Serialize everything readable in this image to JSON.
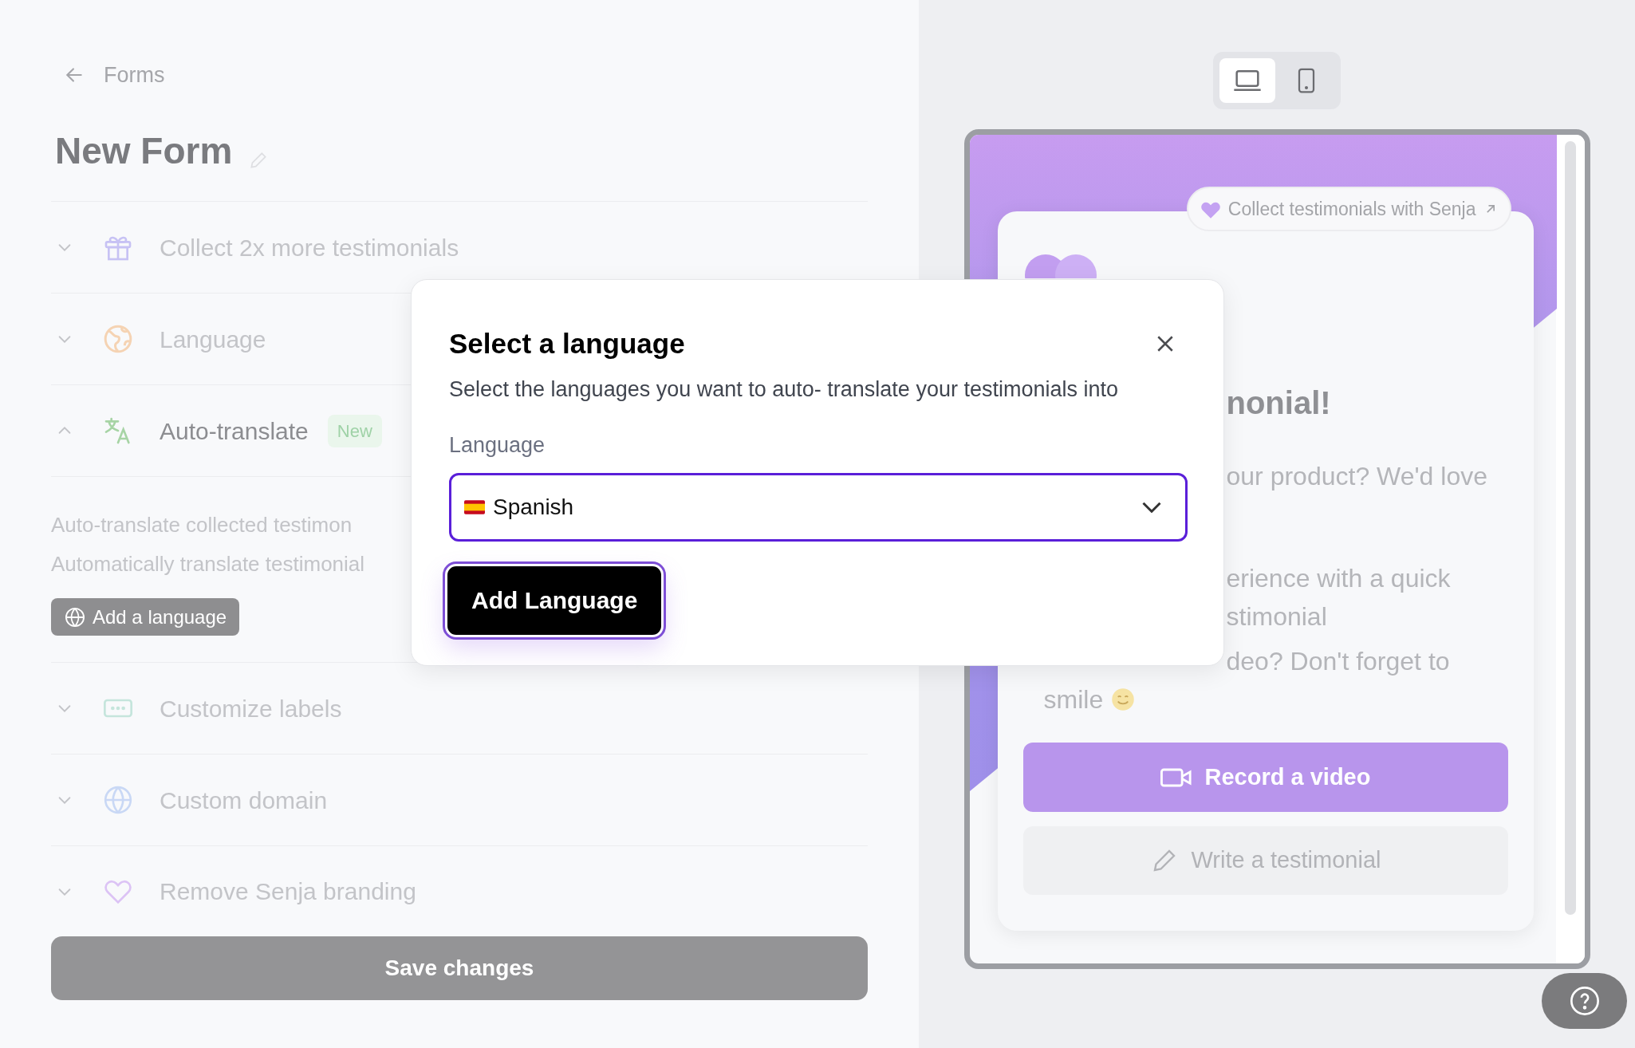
{
  "breadcrumb": {
    "label": "Forms"
  },
  "title": "New Form",
  "sections": [
    {
      "label": "Collect 2x more testimonials",
      "expanded": false
    },
    {
      "label": "Language",
      "expanded": false
    },
    {
      "label": "Auto-translate",
      "expanded": true,
      "badge": "New",
      "description": [
        "Auto-translate collected testimon",
        "Automatically translate testimonial"
      ],
      "button": "Add a language"
    },
    {
      "label": "Customize labels",
      "expanded": false
    },
    {
      "label": "Custom domain",
      "expanded": false
    },
    {
      "label": "Remove Senja branding",
      "expanded": false
    }
  ],
  "save_button": "Save changes",
  "device_toggle": [
    {
      "selected": true
    },
    {
      "selected": false
    }
  ],
  "preview": {
    "badge": "Collect testimonials with Senja",
    "heading": "nonial!",
    "lines": [
      "our product? We'd love",
      "erience with a quick",
      "stimonial",
      "deo? Don't forget to"
    ],
    "last_line": "smile",
    "record_button": "Record a video",
    "write_button": "Write a testimonial"
  },
  "modal": {
    "title": "Select a language",
    "subtitle": "Select the languages you want to auto- translate your testimonials into",
    "field_label": "Language",
    "value": "Spanish",
    "button": "Add Language"
  }
}
